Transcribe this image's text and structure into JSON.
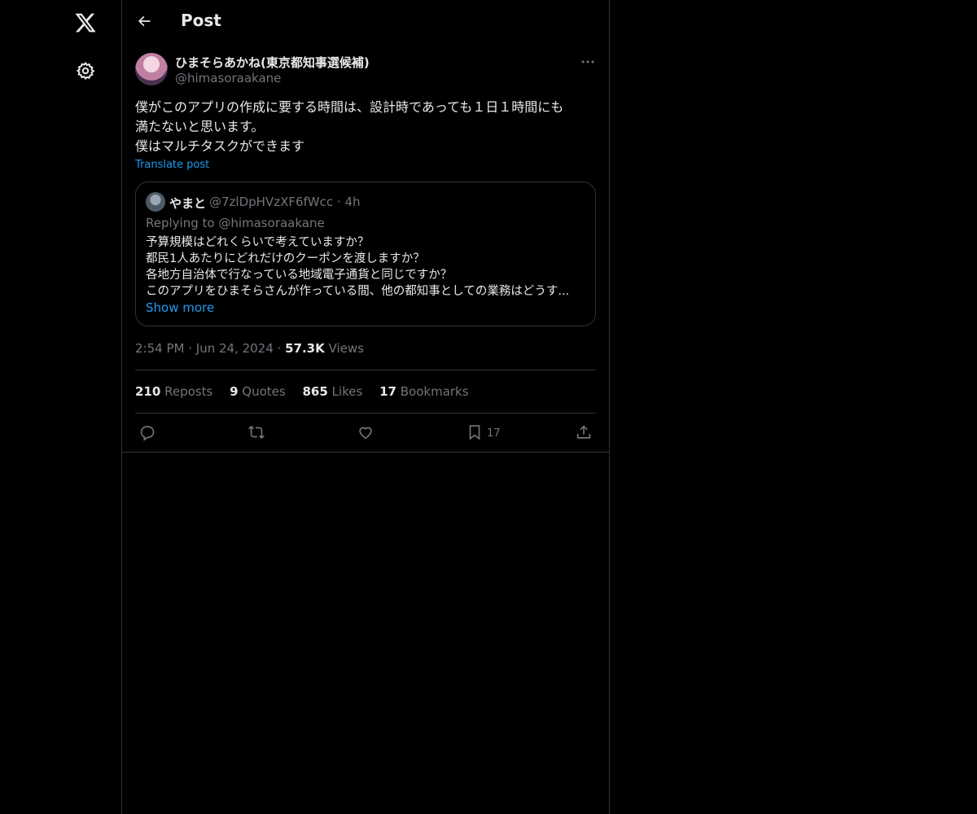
{
  "header": {
    "title": "Post"
  },
  "post": {
    "author_name": "ひまそらあかね(東京都知事選候補)",
    "author_handle": "@himasoraakane",
    "text_lines": [
      "僕がこのアプリの作成に要する時間は、設計時であっても１日１時間にも",
      "満たないと思います。",
      "僕はマルチタスクができます"
    ],
    "translate_label": "Translate post",
    "quote": {
      "author_name": "やまと",
      "author_handle": "@7zlDpHVzXF6fWcc",
      "time": "4h",
      "replying_to": "Replying to @himasoraakane",
      "lines": [
        "予算規模はどれくらいで考えていますか？",
        "都民1人あたりにどれだけのクーポンを渡しますか？",
        "各地方自治体で行なっている地域電子通貨と同じですか？",
        "このアプリをひまそらさんが作っている間、他の都知事としての業務はどうす..."
      ],
      "show_more": "Show more"
    },
    "time": "2:54 PM",
    "date": "Jun 24, 2024",
    "views_count": "57.3K",
    "views_label": "Views",
    "stats": {
      "reposts_count": "210",
      "reposts_label": "Reposts",
      "quotes_count": "9",
      "quotes_label": "Quotes",
      "likes_count": "865",
      "likes_label": "Likes",
      "bookmarks_count": "17",
      "bookmarks_label": "Bookmarks"
    },
    "actions": {
      "bookmark_count": "17"
    }
  },
  "colors": {
    "background": "#000000",
    "text": "#e7e9ea",
    "muted": "#71767b",
    "accent": "#1d9bf0",
    "border": "#2f3336"
  }
}
